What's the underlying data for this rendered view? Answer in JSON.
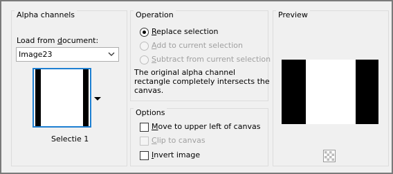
{
  "alpha_channels": {
    "title": "Alpha channels",
    "load_from_label_pre": "Load from ",
    "load_from_label_ul": "d",
    "load_from_label_post": "ocument:",
    "document_value": "Image23",
    "selection_name": "Selectie 1"
  },
  "operation": {
    "title": "Operation",
    "options": [
      {
        "ul": "R",
        "rest": "eplace selection",
        "checked": true,
        "disabled": false
      },
      {
        "ul": "A",
        "rest": "dd to current selection",
        "checked": false,
        "disabled": true
      },
      {
        "ul": "S",
        "rest": "ubtract from current selection",
        "checked": false,
        "disabled": true
      }
    ],
    "description_lines": [
      "The original alpha channel",
      "rectangle completely intersects the",
      "canvas."
    ]
  },
  "options": {
    "title": "Options",
    "items": [
      {
        "ul": "M",
        "rest": "ove to upper left of canvas",
        "checked": false,
        "disabled": false
      },
      {
        "ul": "C",
        "rest": "lip to canvas",
        "checked": false,
        "disabled": true
      },
      {
        "ul": "I",
        "rest": "nvert image",
        "checked": false,
        "disabled": false
      }
    ]
  },
  "preview": {
    "title": "Preview"
  },
  "icons": {
    "dropdown": "chevron-down-icon",
    "thumb_dropdown": "triangle-down-icon",
    "navigator": "checkerboard-icon"
  },
  "colors": {
    "accent": "#1e7fd2",
    "disabled_text": "#a0a0a0"
  }
}
